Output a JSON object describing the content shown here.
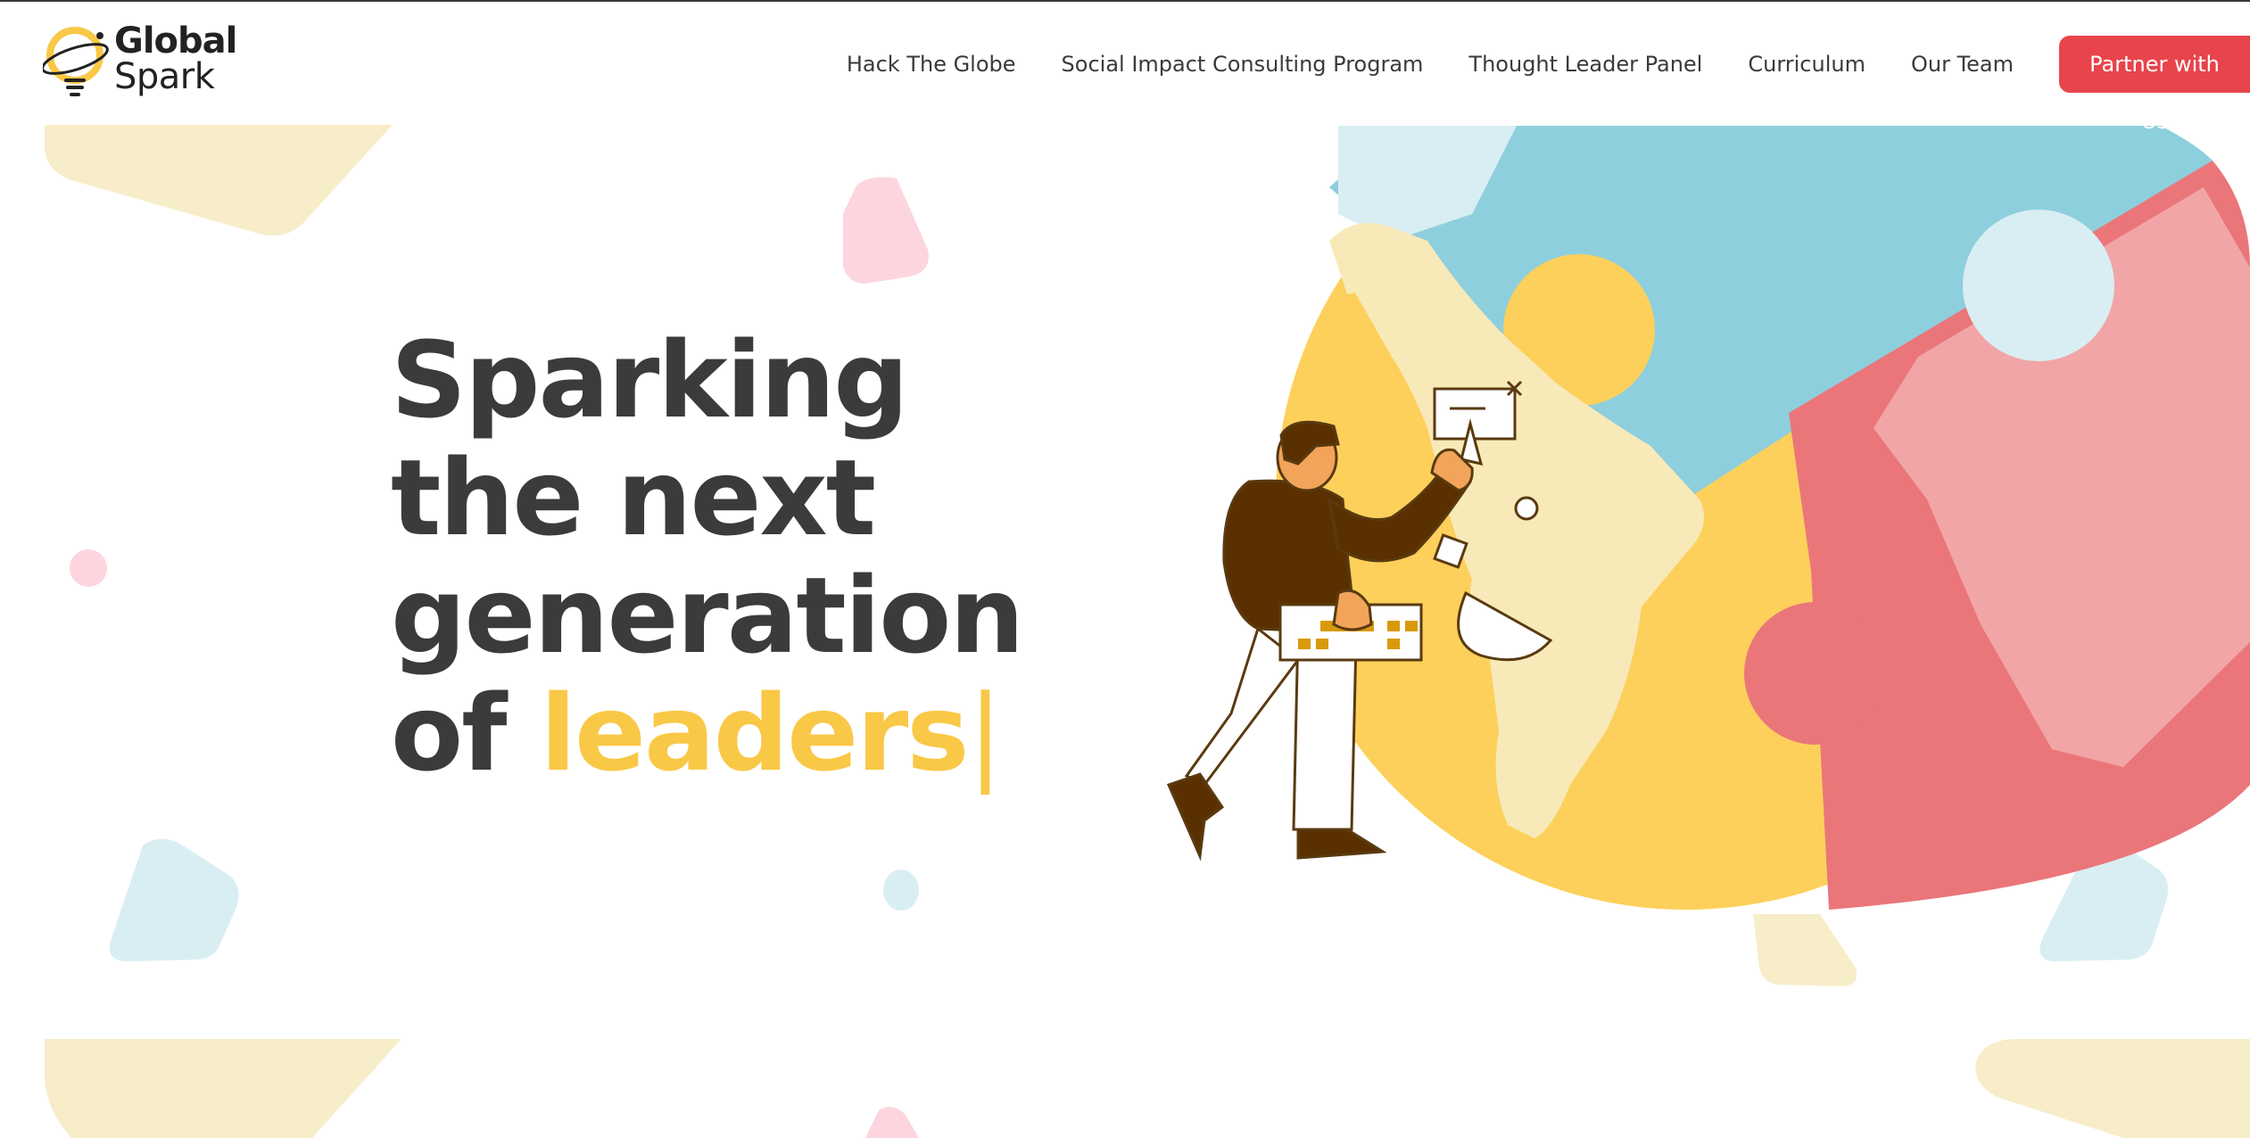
{
  "brand": {
    "line1": "Global",
    "line2": "Spark",
    "logo_icon": "lightbulb-orbit-logo",
    "accent": "#f9c847"
  },
  "nav": {
    "items": [
      {
        "label": "Hack The Globe"
      },
      {
        "label": "Social Impact Consulting Program"
      },
      {
        "label": "Thought Leader Panel"
      },
      {
        "label": "Curriculum"
      },
      {
        "label": "Our Team"
      }
    ],
    "cta_label": "Partner with Us",
    "cta_color": "#e8444c"
  },
  "hero": {
    "line1": "Sparking",
    "line2": "the next",
    "line3": "generation",
    "line4_prefix": "of",
    "line4_highlight": "leaders",
    "cursor": "|",
    "text_color": "#3b3b3d",
    "highlight_color": "#f9c847"
  },
  "illustration": {
    "subject": "person-pointing-at-world-map-illustration",
    "globe_colors": {
      "blue": "#8ecfde",
      "yellow": "#fdd05b",
      "red": "#ea767a"
    }
  }
}
